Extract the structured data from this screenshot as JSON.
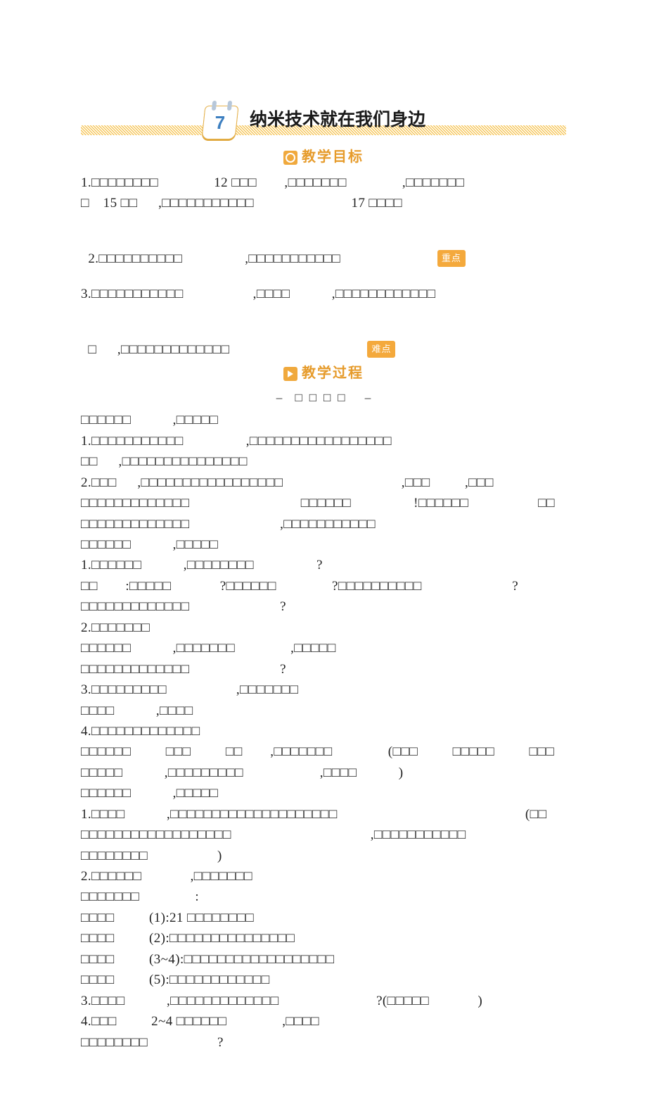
{
  "lesson": {
    "number": "7",
    "title": "纳米技术就在我们身边"
  },
  "section_goals_heading": "教学目标",
  "section_process_heading": "教学过程",
  "process_subheading_left": "–",
  "process_subheading_text": "□□□□",
  "process_subheading_right": "–",
  "badges": {
    "key": "重点",
    "hard": "难点"
  },
  "goals": {
    "g1": "1.□□□□□□□□        12 □□□    ,□□□□□□□        ,□□□□□□□",
    "g1b": "□  15 □□   ,□□□□□□□□□□□              17 □□□□",
    "g2": "2.□□□□□□□□□□         ,□□□□□□□□□□□",
    "g3": "3.□□□□□□□□□□□          ,□□□□      ,□□□□□□□□□□□□",
    "g3b": "□   ,□□□□□□□□□□□□□"
  },
  "proc": {
    "p01": "□□□□□□      ,□□□□□",
    "p02": "1.□□□□□□□□□□□         ,□□□□□□□□□□□□□□□□□",
    "p03": "□□   ,□□□□□□□□□□□□□□□",
    "p04": "2.□□□   ,□□□□□□□□□□□□□□□□□                 ,□□□     ,□□□",
    "p05": "□□□□□□□□□□□□□                □□□□□□         !□□□□□□          □□",
    "p06": "□□□□□□□□□□□□□             ,□□□□□□□□□□□",
    "p07": "□□□□□□      ,□□□□□",
    "p08": "1.□□□□□□      ,□□□□□□□□         ?",
    "p09": "□□    :□□□□□       ?□□□□□□        ?□□□□□□□□□□             ?",
    "p10": "□□□□□□□□□□□□□             ?",
    "p11": "2.□□□□□□□",
    "p12": "□□□□□□      ,□□□□□□□        ,□□□□□",
    "p13": "□□□□□□□□□□□□□             ?",
    "p14": "3.□□□□□□□□□          ,□□□□□□□",
    "p15": "□□□□      ,□□□□",
    "p16": "4.□□□□□□□□□□□□□",
    "p17": "□□□□□□     □□□     □□    ,□□□□□□□        (□□□     □□□□□     □□□",
    "p18": "□□□□□      ,□□□□□□□□□           ,□□□□      )",
    "p19": "□□□□□□      ,□□□□□",
    "p20": "1.□□□□      ,□□□□□□□□□□□□□□□□□□□□                           (□□",
    "p21": "□□□□□□□□□□□□□□□□□□                    ,□□□□□□□□□□□",
    "p22": "□□□□□□□□          )",
    "p23": "2.□□□□□□       ,□□□□□□□",
    "p24": "□□□□□□□        :",
    "p25": "□□□□     (1):21 □□□□□□□□",
    "p26": "□□□□     (2):□□□□□□□□□□□□□□□",
    "p27": "□□□□     (3~4):□□□□□□□□□□□□□□□□□□",
    "p28": "□□□□     (5):□□□□□□□□□□□□",
    "p29": "3.□□□□      ,□□□□□□□□□□□□□              ?(□□□□□       )",
    "p30": "4.□□□     2~4 □□□□□□        ,□□□□",
    "p31": "□□□□□□□□          ?"
  }
}
